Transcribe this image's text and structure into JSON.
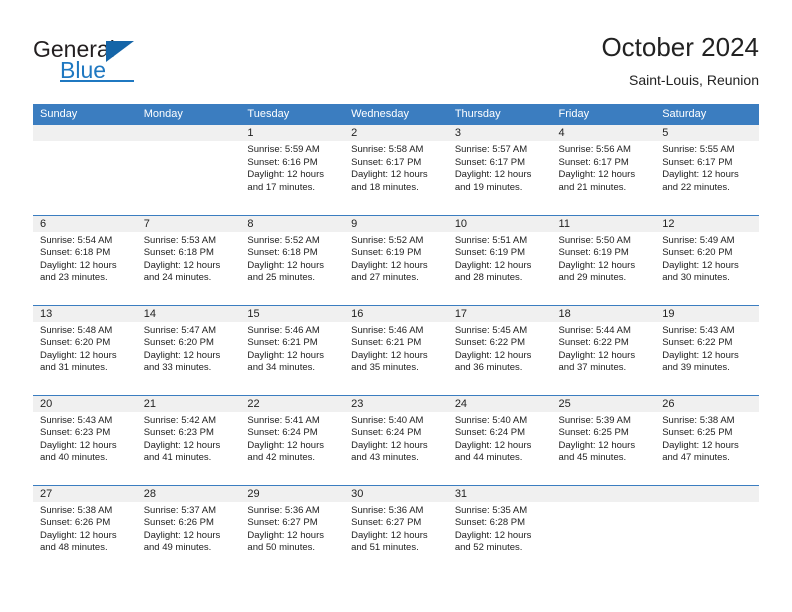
{
  "brand": {
    "name_part1": "General",
    "name_part2": "Blue",
    "triangle_icon": "triangle-icon",
    "accent_color": "#1f78c1",
    "header_color": "#3b7dc0"
  },
  "header": {
    "title": "October 2024",
    "subtitle": "Saint-Louis, Reunion"
  },
  "weekdays": [
    "Sunday",
    "Monday",
    "Tuesday",
    "Wednesday",
    "Thursday",
    "Friday",
    "Saturday"
  ],
  "weeks": [
    [
      {
        "day": "",
        "empty": true,
        "sunrise": "",
        "sunset": "",
        "daylight1": "",
        "daylight2": ""
      },
      {
        "day": "",
        "empty": true,
        "sunrise": "",
        "sunset": "",
        "daylight1": "",
        "daylight2": ""
      },
      {
        "day": "1",
        "sunrise": "Sunrise: 5:59 AM",
        "sunset": "Sunset: 6:16 PM",
        "daylight1": "Daylight: 12 hours",
        "daylight2": "and 17 minutes."
      },
      {
        "day": "2",
        "sunrise": "Sunrise: 5:58 AM",
        "sunset": "Sunset: 6:17 PM",
        "daylight1": "Daylight: 12 hours",
        "daylight2": "and 18 minutes."
      },
      {
        "day": "3",
        "sunrise": "Sunrise: 5:57 AM",
        "sunset": "Sunset: 6:17 PM",
        "daylight1": "Daylight: 12 hours",
        "daylight2": "and 19 minutes."
      },
      {
        "day": "4",
        "sunrise": "Sunrise: 5:56 AM",
        "sunset": "Sunset: 6:17 PM",
        "daylight1": "Daylight: 12 hours",
        "daylight2": "and 21 minutes."
      },
      {
        "day": "5",
        "sunrise": "Sunrise: 5:55 AM",
        "sunset": "Sunset: 6:17 PM",
        "daylight1": "Daylight: 12 hours",
        "daylight2": "and 22 minutes."
      }
    ],
    [
      {
        "day": "6",
        "sunrise": "Sunrise: 5:54 AM",
        "sunset": "Sunset: 6:18 PM",
        "daylight1": "Daylight: 12 hours",
        "daylight2": "and 23 minutes."
      },
      {
        "day": "7",
        "sunrise": "Sunrise: 5:53 AM",
        "sunset": "Sunset: 6:18 PM",
        "daylight1": "Daylight: 12 hours",
        "daylight2": "and 24 minutes."
      },
      {
        "day": "8",
        "sunrise": "Sunrise: 5:52 AM",
        "sunset": "Sunset: 6:18 PM",
        "daylight1": "Daylight: 12 hours",
        "daylight2": "and 25 minutes."
      },
      {
        "day": "9",
        "sunrise": "Sunrise: 5:52 AM",
        "sunset": "Sunset: 6:19 PM",
        "daylight1": "Daylight: 12 hours",
        "daylight2": "and 27 minutes."
      },
      {
        "day": "10",
        "sunrise": "Sunrise: 5:51 AM",
        "sunset": "Sunset: 6:19 PM",
        "daylight1": "Daylight: 12 hours",
        "daylight2": "and 28 minutes."
      },
      {
        "day": "11",
        "sunrise": "Sunrise: 5:50 AM",
        "sunset": "Sunset: 6:19 PM",
        "daylight1": "Daylight: 12 hours",
        "daylight2": "and 29 minutes."
      },
      {
        "day": "12",
        "sunrise": "Sunrise: 5:49 AM",
        "sunset": "Sunset: 6:20 PM",
        "daylight1": "Daylight: 12 hours",
        "daylight2": "and 30 minutes."
      }
    ],
    [
      {
        "day": "13",
        "sunrise": "Sunrise: 5:48 AM",
        "sunset": "Sunset: 6:20 PM",
        "daylight1": "Daylight: 12 hours",
        "daylight2": "and 31 minutes."
      },
      {
        "day": "14",
        "sunrise": "Sunrise: 5:47 AM",
        "sunset": "Sunset: 6:20 PM",
        "daylight1": "Daylight: 12 hours",
        "daylight2": "and 33 minutes."
      },
      {
        "day": "15",
        "sunrise": "Sunrise: 5:46 AM",
        "sunset": "Sunset: 6:21 PM",
        "daylight1": "Daylight: 12 hours",
        "daylight2": "and 34 minutes."
      },
      {
        "day": "16",
        "sunrise": "Sunrise: 5:46 AM",
        "sunset": "Sunset: 6:21 PM",
        "daylight1": "Daylight: 12 hours",
        "daylight2": "and 35 minutes."
      },
      {
        "day": "17",
        "sunrise": "Sunrise: 5:45 AM",
        "sunset": "Sunset: 6:22 PM",
        "daylight1": "Daylight: 12 hours",
        "daylight2": "and 36 minutes."
      },
      {
        "day": "18",
        "sunrise": "Sunrise: 5:44 AM",
        "sunset": "Sunset: 6:22 PM",
        "daylight1": "Daylight: 12 hours",
        "daylight2": "and 37 minutes."
      },
      {
        "day": "19",
        "sunrise": "Sunrise: 5:43 AM",
        "sunset": "Sunset: 6:22 PM",
        "daylight1": "Daylight: 12 hours",
        "daylight2": "and 39 minutes."
      }
    ],
    [
      {
        "day": "20",
        "sunrise": "Sunrise: 5:43 AM",
        "sunset": "Sunset: 6:23 PM",
        "daylight1": "Daylight: 12 hours",
        "daylight2": "and 40 minutes."
      },
      {
        "day": "21",
        "sunrise": "Sunrise: 5:42 AM",
        "sunset": "Sunset: 6:23 PM",
        "daylight1": "Daylight: 12 hours",
        "daylight2": "and 41 minutes."
      },
      {
        "day": "22",
        "sunrise": "Sunrise: 5:41 AM",
        "sunset": "Sunset: 6:24 PM",
        "daylight1": "Daylight: 12 hours",
        "daylight2": "and 42 minutes."
      },
      {
        "day": "23",
        "sunrise": "Sunrise: 5:40 AM",
        "sunset": "Sunset: 6:24 PM",
        "daylight1": "Daylight: 12 hours",
        "daylight2": "and 43 minutes."
      },
      {
        "day": "24",
        "sunrise": "Sunrise: 5:40 AM",
        "sunset": "Sunset: 6:24 PM",
        "daylight1": "Daylight: 12 hours",
        "daylight2": "and 44 minutes."
      },
      {
        "day": "25",
        "sunrise": "Sunrise: 5:39 AM",
        "sunset": "Sunset: 6:25 PM",
        "daylight1": "Daylight: 12 hours",
        "daylight2": "and 45 minutes."
      },
      {
        "day": "26",
        "sunrise": "Sunrise: 5:38 AM",
        "sunset": "Sunset: 6:25 PM",
        "daylight1": "Daylight: 12 hours",
        "daylight2": "and 47 minutes."
      }
    ],
    [
      {
        "day": "27",
        "sunrise": "Sunrise: 5:38 AM",
        "sunset": "Sunset: 6:26 PM",
        "daylight1": "Daylight: 12 hours",
        "daylight2": "and 48 minutes."
      },
      {
        "day": "28",
        "sunrise": "Sunrise: 5:37 AM",
        "sunset": "Sunset: 6:26 PM",
        "daylight1": "Daylight: 12 hours",
        "daylight2": "and 49 minutes."
      },
      {
        "day": "29",
        "sunrise": "Sunrise: 5:36 AM",
        "sunset": "Sunset: 6:27 PM",
        "daylight1": "Daylight: 12 hours",
        "daylight2": "and 50 minutes."
      },
      {
        "day": "30",
        "sunrise": "Sunrise: 5:36 AM",
        "sunset": "Sunset: 6:27 PM",
        "daylight1": "Daylight: 12 hours",
        "daylight2": "and 51 minutes."
      },
      {
        "day": "31",
        "sunrise": "Sunrise: 5:35 AM",
        "sunset": "Sunset: 6:28 PM",
        "daylight1": "Daylight: 12 hours",
        "daylight2": "and 52 minutes."
      },
      {
        "day": "",
        "empty": true,
        "sunrise": "",
        "sunset": "",
        "daylight1": "",
        "daylight2": ""
      },
      {
        "day": "",
        "empty": true,
        "sunrise": "",
        "sunset": "",
        "daylight1": "",
        "daylight2": ""
      }
    ]
  ]
}
